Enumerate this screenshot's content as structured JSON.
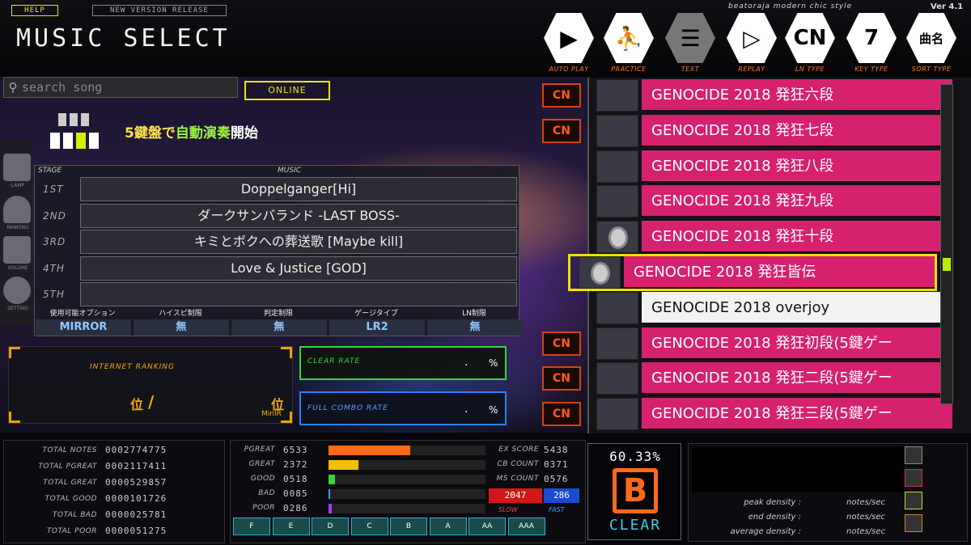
{
  "app": {
    "title": "MUSIC SELECT",
    "version": "Ver 4.1",
    "skin_name": "beatoraja modern chic style"
  },
  "top_buttons": {
    "help": "HELP",
    "new_version": "NEW VERSION RELEASE"
  },
  "toolbar": [
    {
      "label": "AUTO PLAY",
      "icon": "play-icon"
    },
    {
      "label": "PRACTICE",
      "icon": "practice-icon"
    },
    {
      "label": "TEXT",
      "icon": "book-icon"
    },
    {
      "label": "REPLAY",
      "icon": "replay-icon"
    },
    {
      "label": "LN TYPE",
      "icon_text": "CN"
    },
    {
      "label": "KEY TYPE",
      "icon_text": "7"
    },
    {
      "label": "SORT TYPE",
      "icon_text": "曲名"
    }
  ],
  "search": {
    "placeholder": "search song"
  },
  "online_label": "ONLINE",
  "mode": {
    "prefix": "5鍵盤で",
    "middle": "自動演奏",
    "suffix": "開始"
  },
  "course": {
    "header_stage": "STAGE",
    "header_music": "MUSIC",
    "stages": [
      {
        "stage": "1ST",
        "title": "Doppelganger[Hi]"
      },
      {
        "stage": "2ND",
        "title": "ダークサンバランド -LAST BOSS-"
      },
      {
        "stage": "3RD",
        "title": "キミとボクへの葬送歌 [Maybe kill]"
      },
      {
        "stage": "4TH",
        "title": "Love & Justice [GOD]"
      },
      {
        "stage": "5TH",
        "title": ""
      }
    ],
    "options": [
      {
        "header": "使用可能オプション",
        "value": "MIRROR"
      },
      {
        "header": "ハイスピ制限",
        "value": "無"
      },
      {
        "header": "判定制限",
        "value": "無"
      },
      {
        "header": "ゲージタイプ",
        "value": "LR2"
      },
      {
        "header": "LN制限",
        "value": "無"
      }
    ]
  },
  "side_menu": [
    "LAMP",
    "RANKING",
    "VOLUME",
    "SETTING"
  ],
  "ranking": {
    "title": "INTERNET RANKING",
    "rank_unit": "位",
    "slash": "/",
    "mini_unit": "位",
    "mini_label": "MinIR"
  },
  "rates": {
    "clear_label": "CLEAR RATE",
    "clear_dot": ".",
    "clear_pct": "%",
    "fc_label": "FULL COMBO RATE",
    "fc_dot": ".",
    "fc_pct": "%"
  },
  "songs": [
    {
      "title": "GENOCIDE 2018 発狂六段",
      "cn": true,
      "medal": false,
      "color": "pink"
    },
    {
      "title": "GENOCIDE 2018 発狂七段",
      "cn": true,
      "medal": false,
      "color": "pink"
    },
    {
      "title": "GENOCIDE 2018 発狂八段",
      "cn": false,
      "medal": false,
      "color": "pink"
    },
    {
      "title": "GENOCIDE 2018 発狂九段",
      "cn": false,
      "medal": false,
      "color": "pink"
    },
    {
      "title": "GENOCIDE 2018 発狂十段",
      "cn": false,
      "medal": true,
      "color": "pink"
    },
    {
      "title": "GENOCIDE 2018 発狂皆伝",
      "cn": false,
      "medal": true,
      "color": "pink",
      "selected": true
    },
    {
      "title": "GENOCIDE 2018 overjoy",
      "cn": false,
      "medal": false,
      "color": "white"
    },
    {
      "title": "GENOCIDE 2018 発狂初段(5鍵ゲー",
      "cn": true,
      "medal": false,
      "color": "pink"
    },
    {
      "title": "GENOCIDE 2018 発狂二段(5鍵ゲー",
      "cn": true,
      "medal": false,
      "color": "pink"
    },
    {
      "title": "GENOCIDE 2018 発狂三段(5鍵ゲー",
      "cn": true,
      "medal": false,
      "color": "pink"
    }
  ],
  "cn_label": "CN",
  "totals": [
    {
      "label": "TOTAL NOTES",
      "value": "0002774775"
    },
    {
      "label": "TOTAL PGREAT",
      "value": "0002117411"
    },
    {
      "label": "TOTAL GREAT",
      "value": "0000529857"
    },
    {
      "label": "TOTAL GOOD",
      "value": "0000101726"
    },
    {
      "label": "TOTAL BAD",
      "value": "0000025781"
    },
    {
      "label": "TOTAL POOR",
      "value": "0000051275"
    }
  ],
  "judges": [
    {
      "label": "PGREAT",
      "value": "6533",
      "fill": 0.52,
      "color": "#ff6a1a"
    },
    {
      "label": "GREAT",
      "value": "2372",
      "fill": 0.19,
      "color": "#f0c000"
    },
    {
      "label": "GOOD",
      "value": "0518",
      "fill": 0.04,
      "color": "#3ad43a"
    },
    {
      "label": "BAD",
      "value": "0085",
      "fill": 0.01,
      "color": "#33a0ff"
    },
    {
      "label": "POOR",
      "value": "0286",
      "fill": 0.02,
      "color": "#a040ff"
    }
  ],
  "score_info": [
    {
      "label": "EX SCORE",
      "value": "5438"
    },
    {
      "label": "CB COUNT",
      "value": "0371"
    },
    {
      "label": "MS COUNT",
      "value": "0576"
    }
  ],
  "fast_slow": {
    "slow_value": "2047",
    "fast_value": "286",
    "slow_label": "SLOW",
    "fast_label": "FAST"
  },
  "grades": [
    "F",
    "E",
    "D",
    "C",
    "B",
    "A",
    "AA",
    "AAA"
  ],
  "result": {
    "rate": "60.33%",
    "grade": "B",
    "clear": "CLEAR"
  },
  "density": [
    {
      "label": "peak density :",
      "unit": "notes/sec"
    },
    {
      "label": "end density :",
      "unit": "notes/sec"
    },
    {
      "label": "average density :",
      "unit": "notes/sec"
    }
  ],
  "colors": {
    "pink": "#d6216f",
    "accent_yellow": "#e8e800",
    "cn_orange": "#ff5a16"
  }
}
